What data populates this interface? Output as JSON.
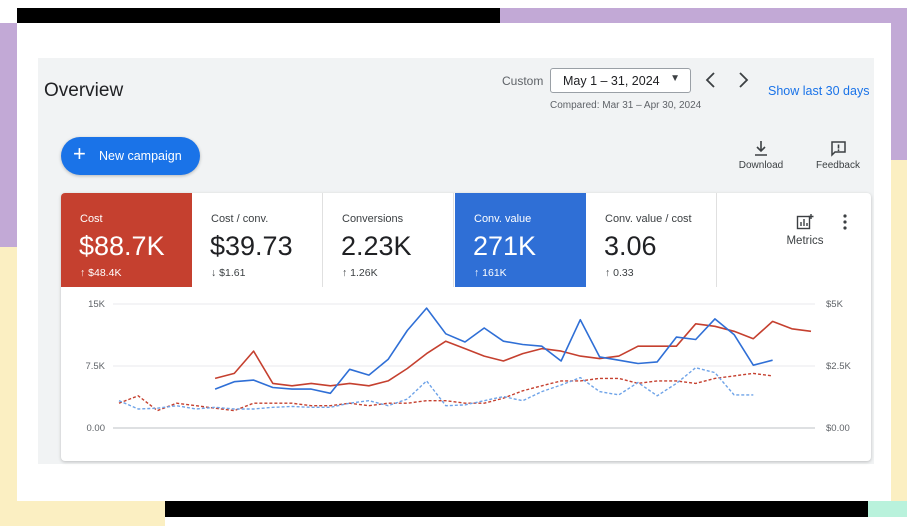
{
  "header": {
    "title": "Overview",
    "custom_label": "Custom",
    "date_range": "May 1 – 31, 2024",
    "compared": "Compared: Mar 31 – Apr 30, 2024",
    "show_last": "Show last 30 days"
  },
  "toolbar": {
    "new_campaign": "New campaign",
    "download": "Download",
    "feedback": "Feedback"
  },
  "scorecards": [
    {
      "name": "Cost",
      "value": "$88.7K",
      "delta": "↑ $48.4K"
    },
    {
      "name": "Cost / conv.",
      "value": "$39.73",
      "delta": "↓ $1.61"
    },
    {
      "name": "Conversions",
      "value": "2.23K",
      "delta": "↑ 1.26K"
    },
    {
      "name": "Conv. value",
      "value": "271K",
      "delta": "↑ 161K"
    },
    {
      "name": "Conv. value / cost",
      "value": "3.06",
      "delta": "↑ 0.33"
    }
  ],
  "metrics_label": "Metrics",
  "colors": {
    "cost": "#c5402f",
    "conv_value": "#2f6fd6",
    "accent": "#1a73e8"
  },
  "icons": [
    "plus-icon",
    "chevron-down-icon",
    "chevron-left-icon",
    "chevron-right-icon",
    "download-icon",
    "feedback-icon",
    "metrics-icon",
    "more-vert-icon"
  ],
  "chart_data": {
    "type": "line",
    "y_left_ticks": [
      "15K",
      "7.5K",
      "0.00"
    ],
    "y_right_ticks": [
      "$5K",
      "$2.5K",
      "$0.00"
    ],
    "y_left_range": [
      0,
      15000
    ],
    "y_right_range": [
      0,
      5000
    ],
    "grid": true,
    "series": [
      {
        "axis": "right",
        "color": "#c5402f",
        "dashed": false,
        "values": [
          null,
          null,
          null,
          null,
          null,
          2000,
          2200,
          3100,
          1800,
          1700,
          1800,
          1700,
          1800,
          1700,
          1900,
          2400,
          3000,
          3500,
          3200,
          2900,
          2700,
          3000,
          3200,
          3100,
          2900,
          2800,
          2900,
          3300,
          3300,
          3300,
          4200,
          4100,
          3900,
          3600,
          4300,
          4000,
          3900
        ]
      },
      {
        "axis": "left",
        "color": "#2f6fd6",
        "dashed": false,
        "values": [
          null,
          null,
          null,
          null,
          null,
          4700,
          5600,
          5800,
          4900,
          4700,
          4700,
          4200,
          7100,
          6400,
          8300,
          11800,
          14500,
          11400,
          10400,
          12100,
          10500,
          10100,
          9900,
          8100,
          13100,
          8600,
          8200,
          7800,
          8000,
          11000,
          10700,
          13200,
          11300,
          7600,
          8200,
          null,
          null
        ]
      },
      {
        "axis": "right",
        "color": "#c5402f",
        "dashed": true,
        "values": [
          1000,
          1300,
          700,
          1000,
          900,
          800,
          700,
          1000,
          1000,
          1000,
          900,
          900,
          1000,
          900,
          1000,
          1000,
          1100,
          1100,
          1000,
          1000,
          1200,
          1500,
          1700,
          1900,
          1900,
          2000,
          2000,
          1800,
          1900,
          1900,
          1800,
          2000,
          2100,
          2200,
          2100,
          null,
          null
        ]
      },
      {
        "axis": "left",
        "color": "#6ea3e8",
        "dashed": true,
        "values": [
          3300,
          2300,
          2400,
          2700,
          2300,
          2500,
          2300,
          2300,
          2500,
          2600,
          2500,
          2500,
          3000,
          3300,
          2700,
          3500,
          5700,
          2700,
          2800,
          3300,
          3800,
          3300,
          4400,
          5200,
          6100,
          4400,
          4000,
          5500,
          3900,
          5400,
          7300,
          6700,
          4000,
          4000,
          null,
          null,
          null
        ]
      }
    ]
  }
}
